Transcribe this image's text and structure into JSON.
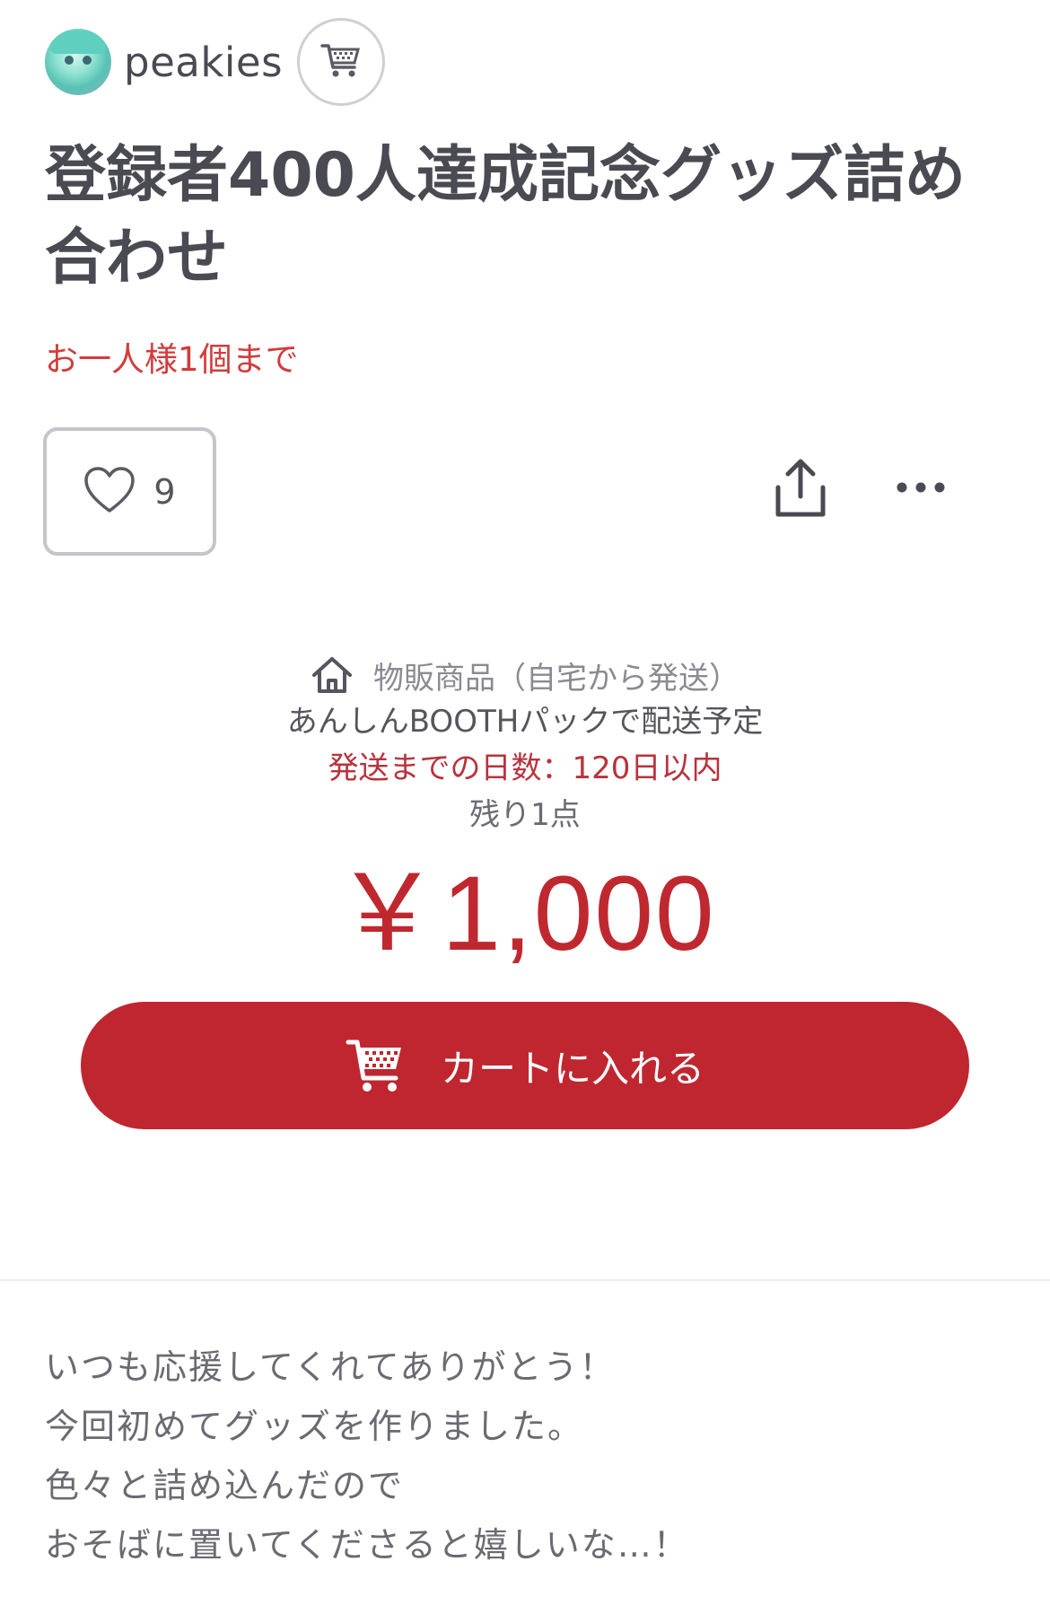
{
  "shop": {
    "name": "peakies"
  },
  "item": {
    "title": "登録者400人達成記念グッズ詰め合わせ",
    "purchase_limit": "お一人様1個まで",
    "like_count": "9",
    "item_type": "物販商品（自宅から発送）",
    "shipping_method": "あんしんBOOTHパックで配送予定",
    "shipping_days": "発送までの日数：120日以内",
    "stock": "残り1点",
    "price": "￥1,000"
  },
  "actions": {
    "add_to_cart_label": "カートに入れる"
  },
  "description": {
    "lines": [
      "いつも応援してくれてありがとう！",
      "今回初めてグッズを作りました。",
      "色々と詰め込んだので",
      "おそばに置いてくださると嬉しいな…！"
    ]
  },
  "colors": {
    "accent_red": "#c0262f",
    "limit_red": "#d23c3c",
    "text_dark": "#4a4a52"
  },
  "icons": {
    "shop_cart": "cart-icon",
    "like": "heart-icon",
    "share": "share-icon",
    "more": "more-icon",
    "item_type": "home-icon",
    "add_to_cart": "cart-icon"
  }
}
